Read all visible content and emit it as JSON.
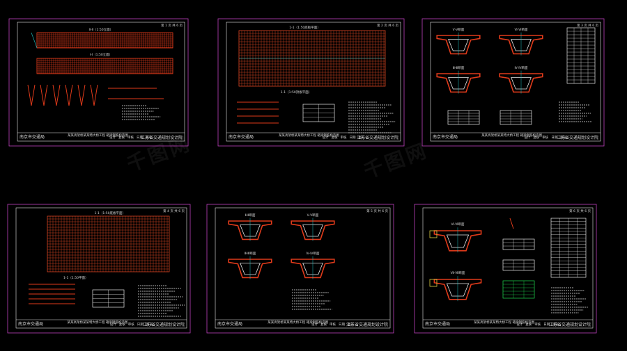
{
  "colors": {
    "background": "#000000",
    "sheet_border": "#c040c0",
    "inner_border": "#e8e8e8",
    "rebar_grid": "#e03a1a",
    "rebar_mesh": "#c8401e",
    "cyan_lines": "#20c8c8",
    "yellow_text": "#e0d040",
    "green_table": "#20e050"
  },
  "watermark": {
    "text": "千图网"
  },
  "sheets": [
    {
      "id": "sheet-1",
      "views": [
        "Ⅱ-Ⅱ（1:50立面）",
        "Ⅰ-Ⅰ（1:50立面）"
      ],
      "page_label": "第 1 页 共 6 页",
      "title_left": "南京市交通局",
      "title_mid": "某某高架桥某某特大桥工程 箱梁钢筋构造图",
      "title_roles": [
        "设计",
        "复核",
        "审核",
        "日期",
        "图号"
      ],
      "title_right": "江苏省交通规划设计院"
    },
    {
      "id": "sheet-2",
      "views": [
        "1-1（1:50底板平面）",
        "1-1（1:50顶板平面）"
      ],
      "page_label": "第 2 页 共 6 页",
      "title_left": "南京市交通局",
      "title_mid": "某某高架桥某某特大桥工程 箱梁钢筋构造图",
      "title_roles": [
        "设计",
        "复核",
        "审核",
        "日期",
        "图号"
      ],
      "title_right": "江苏省交通规划设计院"
    },
    {
      "id": "sheet-3",
      "views": [
        "Ⅴ-Ⅴ断面",
        "Ⅵ-Ⅵ断面",
        "Ⅲ-Ⅲ断面",
        "Ⅳ-Ⅳ断面"
      ],
      "page_label": "第 3 页 共 6 页",
      "title_left": "南京市交通局",
      "title_mid": "某某高架桥某某特大桥工程 箱梁钢筋构造图",
      "title_roles": [
        "设计",
        "复核",
        "审核",
        "日期",
        "图号"
      ],
      "title_right": "江苏省交通规划设计院"
    },
    {
      "id": "sheet-4",
      "views": [
        "1-1（1:50底板平面）",
        "1-1（1:50平面）"
      ],
      "page_label": "第 4 页 共 6 页",
      "title_left": "南京市交通局",
      "title_mid": "某某高架桥某某特大桥工程 箱梁钢筋构造图",
      "title_roles": [
        "设计",
        "复核",
        "审核",
        "日期",
        "图号"
      ],
      "title_right": "江苏省交通规划设计院"
    },
    {
      "id": "sheet-5",
      "views": [
        "Ⅱ-Ⅱ断面",
        "Ⅴ-Ⅴ断面",
        "Ⅲ-Ⅲ断面",
        "Ⅳ-Ⅳ断面"
      ],
      "page_label": "第 5 页 共 6 页",
      "title_left": "南京市交通局",
      "title_mid": "某某高架桥某某特大桥工程 箱梁钢筋构造图",
      "title_roles": [
        "设计",
        "复核",
        "审核",
        "日期",
        "图号"
      ],
      "title_right": "江苏省交通规划设计院"
    },
    {
      "id": "sheet-6",
      "views": [
        "Ⅵ-Ⅵ断面",
        "Ⅶ-Ⅶ断面"
      ],
      "page_label": "第 6 页 共 6 页",
      "title_left": "南京市交通局",
      "title_mid": "某某高架桥某某特大桥工程 箱梁钢筋构造图",
      "title_roles": [
        "设计",
        "复核",
        "审核",
        "日期",
        "图号"
      ],
      "title_right": "江苏省交通规划设计院"
    }
  ]
}
